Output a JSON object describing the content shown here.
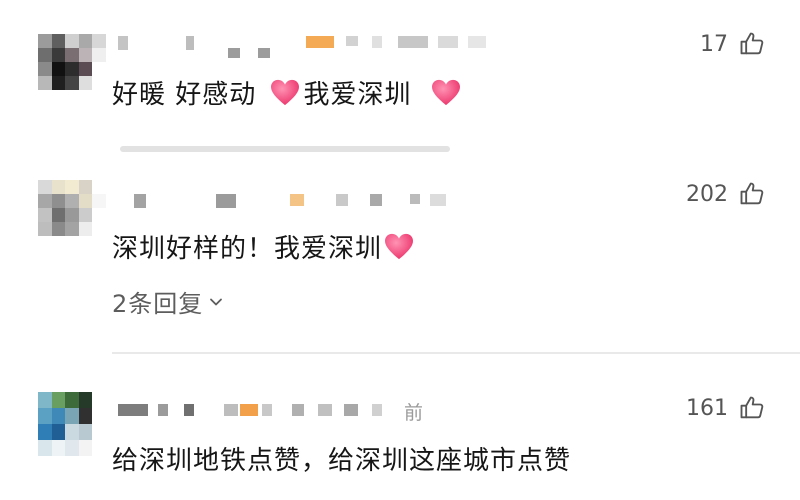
{
  "comments": [
    {
      "text_before": "好暖 好感动",
      "text_middle": "我爱深圳",
      "text_after": "",
      "likes": "17"
    },
    {
      "text_before": "深圳好样的！我爱深圳",
      "likes": "202",
      "replies_label": "2条回复"
    },
    {
      "time_fragment": "前",
      "text": "给深圳地铁点赞，给深圳这座城市点赞",
      "likes": "161"
    }
  ],
  "icons": {
    "like": "thumbs-up-icon",
    "heart": "heart-icon",
    "chevron": "chevron-down-icon"
  },
  "colors": {
    "heart": "#f0457a",
    "meta_gray": "#b5b5b5",
    "text": "#161616",
    "secondary": "#5d5d5d"
  }
}
